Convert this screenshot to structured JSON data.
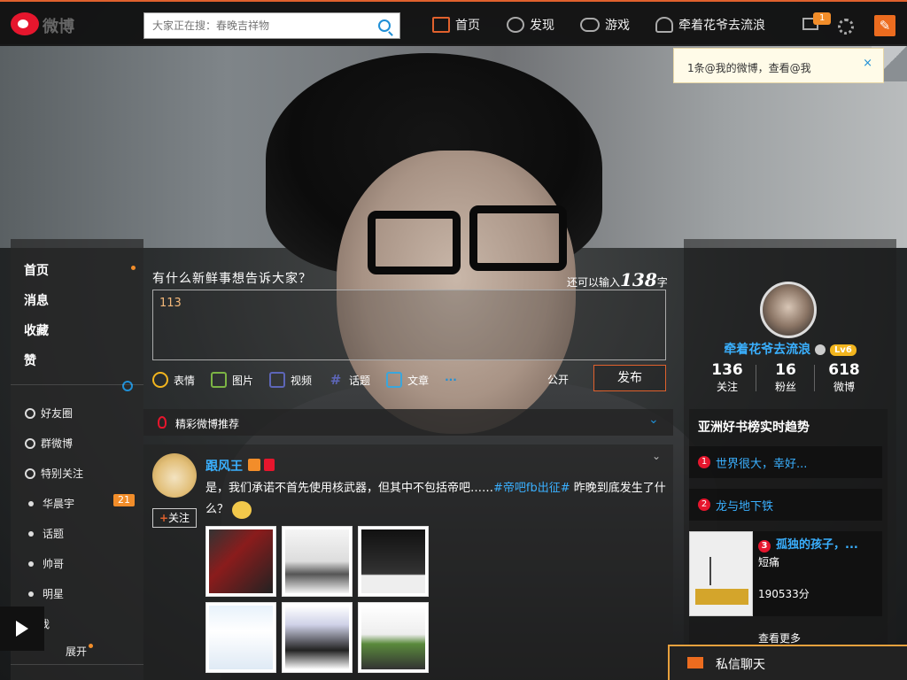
{
  "topbar": {
    "logo_text": "微博",
    "search_placeholder": "大家正在搜：春晚吉祥物",
    "nav": {
      "home": "首页",
      "discover": "发现",
      "games": "游戏",
      "username": "牵着花爷去流浪"
    },
    "mail_count": "1",
    "compose_icon": "compose-icon"
  },
  "notification": {
    "text": "1条@我的微博，查看@我",
    "close": "×"
  },
  "left_nav": {
    "main": [
      "首页",
      "消息",
      "收藏",
      "赞"
    ],
    "groups": [
      {
        "label": "好友圈",
        "icon": "friends-circle-icon"
      },
      {
        "label": "群微博",
        "icon": "group-weibo-icon"
      },
      {
        "label": "特别关注",
        "icon": "special-follow-icon"
      }
    ],
    "tags": [
      "华晨宇",
      "话题",
      "帅哥",
      "明星"
    ],
    "hua_badge": "21",
    "partial_item": "我",
    "expand": "展开"
  },
  "publisher": {
    "prompt": "有什么新鲜事想告诉大家？",
    "count_prefix": "还可以输入",
    "count_number": "138",
    "count_suffix": "字",
    "input_value": "113",
    "tools": [
      "表情",
      "图片",
      "视频",
      "话题",
      "文章",
      "···"
    ],
    "visibility": "公开",
    "publish": "发布"
  },
  "feed": {
    "header": "精彩微博推荐",
    "post": {
      "author": "跟风王",
      "follow_plus": "+",
      "follow_label": "关注",
      "text_before": "是，我们承诺不首先使用核武器，但其中不包括帝吧……",
      "hashtag": "#帝吧fb出征#",
      "text_after": " 昨晚到底发生了什么？"
    }
  },
  "profile": {
    "name": "牵着花爷去流浪",
    "level": "Lv6",
    "stats": [
      {
        "value": "136",
        "label": "关注"
      },
      {
        "value": "16",
        "label": "粉丝"
      },
      {
        "value": "618",
        "label": "微博"
      }
    ]
  },
  "trends": {
    "title": "亚洲好书榜实时趋势",
    "items": [
      {
        "rank": "1",
        "text": "世界很大，幸好..."
      },
      {
        "rank": "2",
        "text": "龙与地下铁"
      }
    ],
    "book": {
      "rank": "3",
      "title": "孤独的孩子，...",
      "author": "短痛",
      "score": "190533分"
    },
    "see_more": "查看更多"
  },
  "chat": {
    "label": "私信聊天"
  },
  "colors": {
    "accent": "#e0612d",
    "link": "#3ab0ff",
    "badge": "#f28d2a",
    "weibo_red": "#e6162d"
  }
}
